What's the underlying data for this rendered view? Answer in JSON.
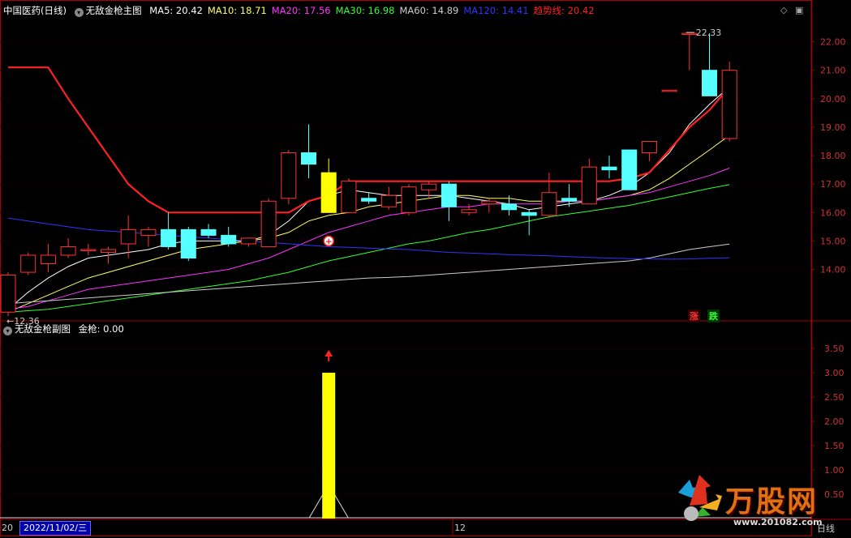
{
  "main_header": {
    "security_name": "中国医药",
    "period": "(日线)",
    "indicator_name": "无敌金枪主图",
    "ma_readouts": [
      {
        "label": "MA5: 20.42",
        "color": "#ffffff"
      },
      {
        "label": "MA10: 18.71",
        "color": "#ffff66"
      },
      {
        "label": "MA20: 17.56",
        "color": "#ff33ff"
      },
      {
        "label": "MA30: 16.98",
        "color": "#33ff33"
      },
      {
        "label": "MA60: 14.89",
        "color": "#cccccc"
      },
      {
        "label": "MA120: 14.41",
        "color": "#3333ff"
      },
      {
        "label": "趋势线: 20.42",
        "color": "#ff2222"
      }
    ]
  },
  "sub_header": {
    "indicator_name": "无敌金枪副图",
    "readout": "金枪: 0.00"
  },
  "price_labels": {
    "high_marker": "22.33",
    "low_marker": "12.36"
  },
  "badges": {
    "rise": "涨",
    "fall": "跌"
  },
  "footer": {
    "left_cut": "20",
    "date": "2022/11/02/三",
    "month_tick": "12",
    "period_label": "日线"
  },
  "watermark": {
    "brand": "万股网",
    "url": "www.201082.com"
  },
  "colors": {
    "up": "#ff3333",
    "down": "#55ffff",
    "axis": "#aa0000",
    "grid": "#330000",
    "signal": "#ffff00"
  },
  "chart_data": [
    {
      "type": "candlestick",
      "title": "无敌金枪主图",
      "y_ticks": [
        14.0,
        15.0,
        16.0,
        17.0,
        18.0,
        19.0,
        20.0,
        21.0,
        22.0
      ],
      "ylim": [
        12.25,
        22.9
      ],
      "candles": [
        {
          "o": 12.5,
          "h": 13.9,
          "l": 12.36,
          "c": 13.8
        },
        {
          "o": 13.9,
          "h": 14.6,
          "l": 13.8,
          "c": 14.5
        },
        {
          "o": 14.2,
          "h": 14.9,
          "l": 13.9,
          "c": 14.5
        },
        {
          "o": 14.5,
          "h": 15.1,
          "l": 14.4,
          "c": 14.8
        },
        {
          "o": 14.7,
          "h": 14.9,
          "l": 14.5,
          "c": 14.7
        },
        {
          "o": 14.6,
          "h": 14.8,
          "l": 14.2,
          "c": 14.7
        },
        {
          "o": 14.9,
          "h": 15.9,
          "l": 14.4,
          "c": 15.4
        },
        {
          "o": 15.2,
          "h": 15.5,
          "l": 14.8,
          "c": 15.4
        },
        {
          "o": 15.4,
          "h": 16.0,
          "l": 14.7,
          "c": 14.8
        },
        {
          "o": 15.4,
          "h": 15.5,
          "l": 14.3,
          "c": 14.4
        },
        {
          "o": 15.4,
          "h": 15.6,
          "l": 15.1,
          "c": 15.2
        },
        {
          "o": 15.2,
          "h": 15.5,
          "l": 14.8,
          "c": 14.9
        },
        {
          "o": 14.9,
          "h": 15.1,
          "l": 14.8,
          "c": 15.1
        },
        {
          "o": 14.8,
          "h": 16.5,
          "l": 14.8,
          "c": 16.4
        },
        {
          "o": 16.5,
          "h": 18.2,
          "l": 16.3,
          "c": 18.1
        },
        {
          "o": 18.1,
          "h": 19.1,
          "l": 17.2,
          "c": 17.7
        },
        {
          "o": 17.4,
          "h": 17.9,
          "l": 16.0,
          "c": 16.0
        },
        {
          "o": 16.0,
          "h": 17.2,
          "l": 16.0,
          "c": 17.1
        },
        {
          "o": 16.5,
          "h": 16.7,
          "l": 16.3,
          "c": 16.4
        },
        {
          "o": 16.2,
          "h": 16.9,
          "l": 16.1,
          "c": 16.6
        },
        {
          "o": 16.0,
          "h": 17.0,
          "l": 15.9,
          "c": 16.9
        },
        {
          "o": 16.8,
          "h": 17.1,
          "l": 16.5,
          "c": 17.0
        },
        {
          "o": 17.0,
          "h": 17.1,
          "l": 15.7,
          "c": 16.2
        },
        {
          "o": 16.0,
          "h": 16.3,
          "l": 15.9,
          "c": 16.1
        },
        {
          "o": 16.3,
          "h": 16.5,
          "l": 16.0,
          "c": 16.4
        },
        {
          "o": 16.3,
          "h": 16.6,
          "l": 15.9,
          "c": 16.1
        },
        {
          "o": 16.0,
          "h": 16.1,
          "l": 15.2,
          "c": 15.9
        },
        {
          "o": 15.9,
          "h": 17.4,
          "l": 15.8,
          "c": 16.7
        },
        {
          "o": 16.5,
          "h": 17.0,
          "l": 16.2,
          "c": 16.4
        },
        {
          "o": 16.3,
          "h": 17.9,
          "l": 16.3,
          "c": 17.6
        },
        {
          "o": 17.6,
          "h": 18.0,
          "l": 17.2,
          "c": 17.5
        },
        {
          "o": 18.2,
          "h": 18.2,
          "l": 16.8,
          "c": 16.8
        },
        {
          "o": 18.1,
          "h": 18.5,
          "l": 17.8,
          "c": 18.5
        },
        {
          "o": 20.3,
          "h": 20.3,
          "l": 20.3,
          "c": 20.3
        },
        {
          "o": 22.3,
          "h": 22.33,
          "l": 21.0,
          "c": 22.3
        },
        {
          "o": 21.0,
          "h": 22.3,
          "l": 20.1,
          "c": 20.1
        },
        {
          "o": 18.6,
          "h": 21.3,
          "l": 18.5,
          "c": 21.0
        }
      ],
      "series": [
        {
          "name": "MA5",
          "color": "#ffffff",
          "values": [
            12.6,
            13.2,
            13.7,
            14.1,
            14.4,
            14.5,
            14.6,
            14.7,
            14.9,
            15.0,
            15.0,
            15.0,
            15.0,
            15.2,
            15.7,
            16.4,
            16.6,
            16.8,
            16.7,
            16.6,
            16.6,
            16.6,
            16.6,
            16.5,
            16.4,
            16.3,
            16.1,
            16.2,
            16.3,
            16.4,
            16.6,
            16.9,
            17.4,
            18.1,
            19.1,
            19.8,
            20.42
          ]
        },
        {
          "name": "MA10",
          "color": "#ffff66",
          "values": [
            12.5,
            12.8,
            13.1,
            13.4,
            13.7,
            13.9,
            14.1,
            14.3,
            14.5,
            14.7,
            14.8,
            14.9,
            15.0,
            15.1,
            15.3,
            15.7,
            15.9,
            16.0,
            16.2,
            16.3,
            16.4,
            16.5,
            16.6,
            16.6,
            16.5,
            16.5,
            16.4,
            16.4,
            16.4,
            16.4,
            16.5,
            16.6,
            16.8,
            17.2,
            17.7,
            18.2,
            18.71
          ]
        },
        {
          "name": "MA20",
          "color": "#ff33ff",
          "values": [
            12.6,
            12.7,
            12.9,
            13.1,
            13.3,
            13.4,
            13.5,
            13.6,
            13.7,
            13.8,
            13.9,
            14.0,
            14.2,
            14.4,
            14.7,
            15.0,
            15.3,
            15.5,
            15.7,
            15.9,
            16.0,
            16.1,
            16.2,
            16.2,
            16.3,
            16.3,
            16.3,
            16.3,
            16.4,
            16.4,
            16.5,
            16.6,
            16.7,
            16.9,
            17.1,
            17.3,
            17.56
          ]
        },
        {
          "name": "MA30",
          "color": "#33ff33",
          "values": [
            12.5,
            12.55,
            12.6,
            12.7,
            12.8,
            12.9,
            13.0,
            13.1,
            13.2,
            13.3,
            13.4,
            13.5,
            13.6,
            13.75,
            13.9,
            14.1,
            14.3,
            14.45,
            14.6,
            14.75,
            14.9,
            15.0,
            15.15,
            15.3,
            15.4,
            15.55,
            15.7,
            15.85,
            15.95,
            16.05,
            16.15,
            16.25,
            16.4,
            16.55,
            16.7,
            16.85,
            16.98
          ]
        },
        {
          "name": "MA60",
          "color": "#cccccc",
          "values": [
            12.8,
            12.85,
            12.9,
            12.95,
            13.0,
            13.05,
            13.1,
            13.15,
            13.2,
            13.25,
            13.3,
            13.35,
            13.4,
            13.45,
            13.5,
            13.55,
            13.6,
            13.65,
            13.7,
            13.72,
            13.75,
            13.8,
            13.85,
            13.9,
            13.95,
            14.0,
            14.05,
            14.1,
            14.15,
            14.2,
            14.25,
            14.3,
            14.4,
            14.55,
            14.7,
            14.8,
            14.89
          ]
        },
        {
          "name": "MA120",
          "color": "#3333ff",
          "values": [
            15.8,
            15.7,
            15.6,
            15.5,
            15.4,
            15.35,
            15.3,
            15.25,
            15.2,
            15.15,
            15.1,
            15.05,
            15.0,
            14.95,
            14.9,
            14.85,
            14.8,
            14.78,
            14.75,
            14.72,
            14.7,
            14.65,
            14.6,
            14.58,
            14.55,
            14.52,
            14.5,
            14.48,
            14.45,
            14.42,
            14.4,
            14.38,
            14.37,
            14.36,
            14.37,
            14.39,
            14.41
          ]
        },
        {
          "name": "趋势线",
          "color": "#ff2222",
          "values": [
            21.1,
            21.1,
            21.1,
            20.0,
            19.0,
            18.0,
            17.0,
            16.4,
            16.0,
            16.0,
            16.0,
            16.0,
            16.0,
            16.0,
            16.0,
            16.4,
            16.6,
            17.1,
            17.1,
            17.1,
            17.1,
            17.1,
            17.1,
            17.1,
            17.1,
            17.1,
            17.1,
            17.1,
            17.1,
            17.1,
            17.1,
            17.2,
            17.4,
            18.2,
            19.0,
            19.6,
            20.42
          ]
        }
      ],
      "signal_index": 16
    },
    {
      "type": "bar",
      "title": "无敌金枪副图",
      "y_ticks": [
        0.5,
        1.0,
        1.5,
        2.0,
        2.5,
        3.0,
        3.5
      ],
      "ylim": [
        0,
        3.75
      ],
      "bar_index": 16,
      "bar_value": 3.0,
      "triangle_peak": 0.7
    }
  ]
}
